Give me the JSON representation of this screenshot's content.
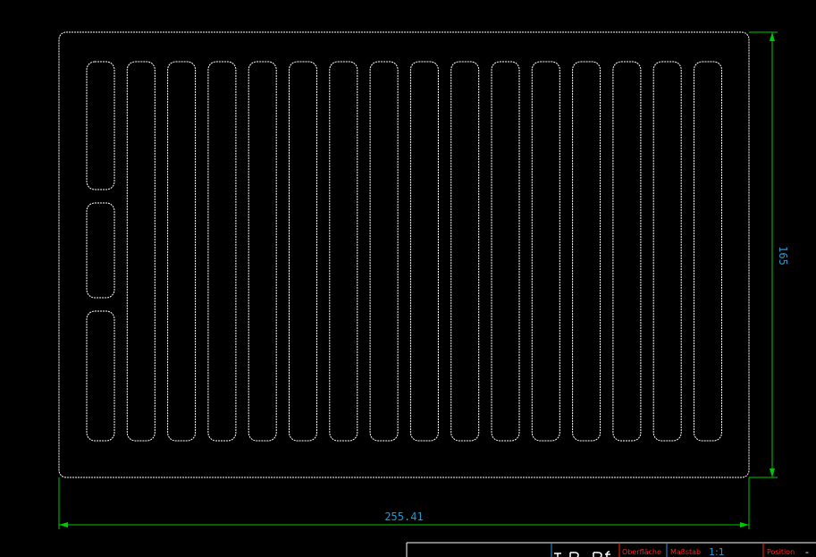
{
  "drawing": {
    "colors": {
      "background": "#000000",
      "outline": "#ffffff",
      "dimension_line": "#00c800",
      "dimension_text": "#1e9bd8",
      "title_block_label": "#ff2020"
    },
    "dimensions": {
      "width_label": "255.41",
      "height_label": "165"
    },
    "title_block": {
      "surface_label": "Oberfläche",
      "scale_label": "Maßstab",
      "scale_value": "1:1",
      "position_label": "Position",
      "position_value": "-"
    },
    "part": {
      "slot_count": 16,
      "left_column_segments": 3
    }
  }
}
